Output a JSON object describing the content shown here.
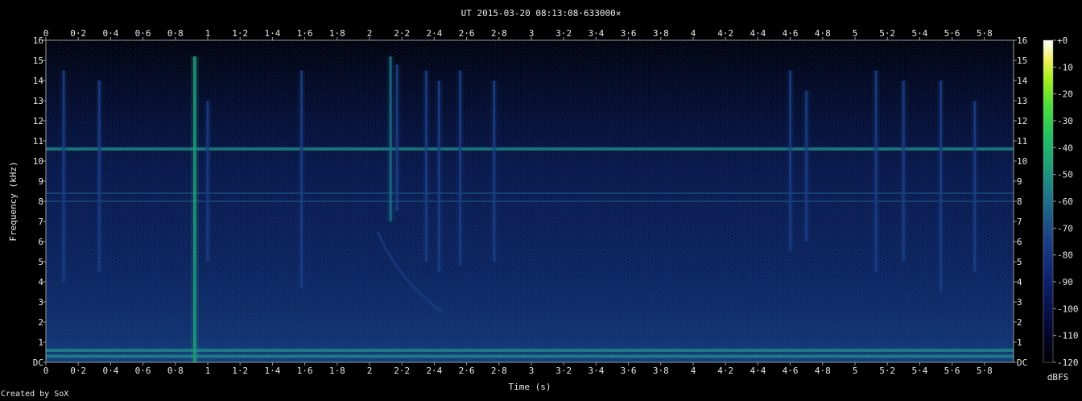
{
  "chart_data": {
    "type": "heatmap",
    "title": "UT 2015-03-20 08:13:08·633000×",
    "xlabel": "Time (s)",
    "ylabel": "Frequency (kHz)",
    "xlim": [
      0,
      5.98
    ],
    "ylim": [
      0,
      16
    ],
    "x_ticks": [
      "0",
      "0·2",
      "0·4",
      "0·6",
      "0·8",
      "1",
      "1·2",
      "1·4",
      "1·6",
      "1·8",
      "2",
      "2·2",
      "2·4",
      "2·6",
      "2·8",
      "3",
      "3·2",
      "3·4",
      "3·6",
      "3·8",
      "4",
      "4·2",
      "4·4",
      "4·6",
      "4·8",
      "5",
      "5·2",
      "5·4",
      "5·6",
      "5·8"
    ],
    "y_ticks": [
      "DC",
      "1",
      "2",
      "3",
      "4",
      "5",
      "6",
      "7",
      "8",
      "9",
      "10",
      "11",
      "12",
      "13",
      "14",
      "15",
      "16"
    ],
    "colorbar": {
      "label": "dBFS",
      "ticks": [
        "+0",
        "-10",
        "-20",
        "-30",
        "-40",
        "-50",
        "-60",
        "-70",
        "-80",
        "-90",
        "-100",
        "-110",
        "-120"
      ],
      "range": [
        -120,
        0
      ]
    },
    "features": {
      "horizontal_lines_khz": [
        10.6,
        8.4,
        8.0,
        0.6,
        0.3
      ],
      "vertical_events": [
        {
          "t": 0.11,
          "f_min": 4.0,
          "f_max": 14.5,
          "level_db": -75
        },
        {
          "t": 0.33,
          "f_min": 4.5,
          "f_max": 14.0,
          "level_db": -85
        },
        {
          "t": 0.92,
          "f_min": 0.0,
          "f_max": 15.2,
          "level_db": -55
        },
        {
          "t": 1.0,
          "f_min": 5.0,
          "f_max": 13.0,
          "level_db": -85
        },
        {
          "t": 1.58,
          "f_min": 3.7,
          "f_max": 14.5,
          "level_db": -75
        },
        {
          "t": 2.13,
          "f_min": 7.0,
          "f_max": 15.2,
          "level_db": -70
        },
        {
          "t": 2.17,
          "f_min": 7.5,
          "f_max": 14.8,
          "level_db": -75
        },
        {
          "t": 2.35,
          "f_min": 5.0,
          "f_max": 14.5,
          "level_db": -75
        },
        {
          "t": 2.43,
          "f_min": 4.5,
          "f_max": 14.0,
          "level_db": -75
        },
        {
          "t": 2.56,
          "f_min": 4.8,
          "f_max": 14.5,
          "level_db": -80
        },
        {
          "t": 2.77,
          "f_min": 5.0,
          "f_max": 14.0,
          "level_db": -80
        },
        {
          "t": 4.6,
          "f_min": 5.5,
          "f_max": 14.5,
          "level_db": -80
        },
        {
          "t": 4.7,
          "f_min": 6.0,
          "f_max": 13.5,
          "level_db": -85
        },
        {
          "t": 5.13,
          "f_min": 4.5,
          "f_max": 14.5,
          "level_db": -75
        },
        {
          "t": 5.3,
          "f_min": 5.0,
          "f_max": 14.0,
          "level_db": -85
        },
        {
          "t": 5.53,
          "f_min": 3.5,
          "f_max": 14.0,
          "level_db": -80
        },
        {
          "t": 5.74,
          "f_min": 4.5,
          "f_max": 13.0,
          "level_db": -85
        }
      ],
      "chirp": {
        "t_start": 2.05,
        "f_start_khz": 6.5,
        "t_end": 2.45,
        "f_end_khz": 2.5,
        "level_db": -85
      }
    }
  },
  "credit": "Created by SoX"
}
